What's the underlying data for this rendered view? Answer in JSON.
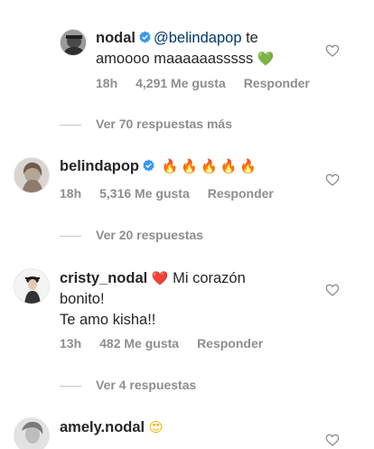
{
  "comments": [
    {
      "username": "nodal",
      "verified": true,
      "mention": "@belindapop",
      "text_line1": " te",
      "text_line2": "amoooo maaaaaasssss",
      "emoji": "💚",
      "time": "18h",
      "likes": "4,291 Me gusta",
      "reply_label": "Responder"
    },
    {
      "username": "belindapop",
      "verified": true,
      "text": "🔥🔥🔥🔥🔥",
      "time": "18h",
      "likes": "5,316 Me gusta",
      "reply_label": "Responder"
    },
    {
      "username": "cristy_nodal",
      "verified": false,
      "emoji": "❤️",
      "text_line1": " Mi corazón",
      "text_line2": "bonito!",
      "text_line3": "Te amo kisha!!",
      "time": "13h",
      "likes": "482 Me gusta",
      "reply_label": "Responder"
    },
    {
      "username": "amely.nodal",
      "verified": false,
      "emoji": "😍"
    }
  ],
  "replies_toggles": [
    "Ver 70 respuestas más",
    "Ver 20 respuestas",
    "Ver 4 respuestas"
  ],
  "icons": {
    "verified": "verified-badge-icon",
    "like": "heart-outline-icon"
  },
  "colors": {
    "text": "#262626",
    "meta": "#8e8e8e",
    "mention": "#00376b",
    "verified": "#3897f0"
  }
}
